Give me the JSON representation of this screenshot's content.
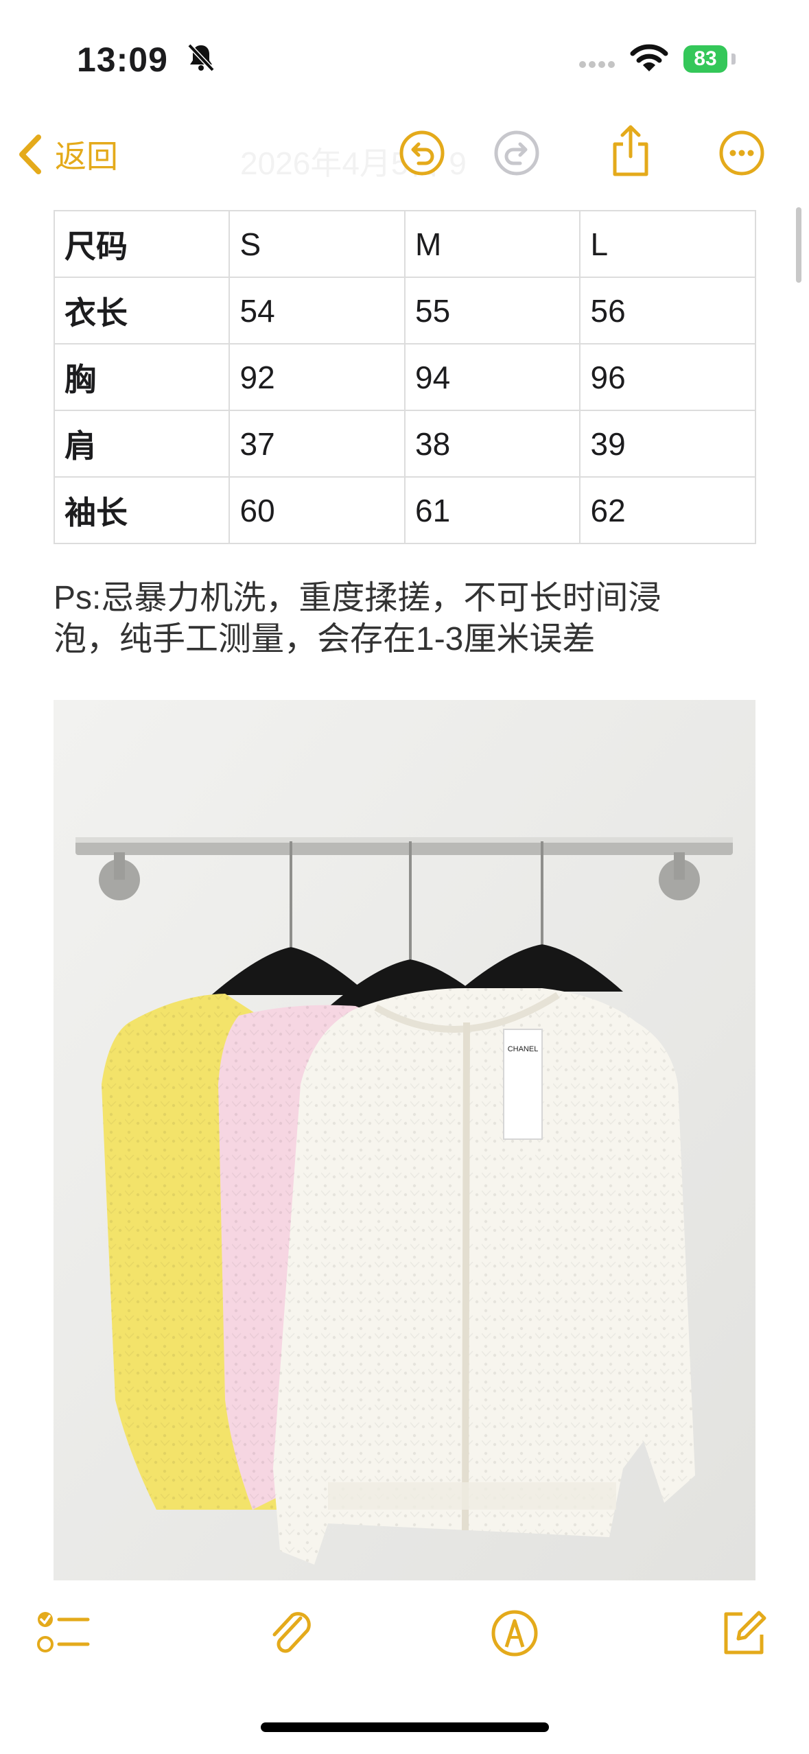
{
  "status_bar": {
    "time": "13:09",
    "battery": "83"
  },
  "nav": {
    "back_label": "返回",
    "title_faint": "2026年4月5日 9"
  },
  "table": {
    "header": [
      "尺码",
      "S",
      "M",
      "L"
    ],
    "rows": [
      [
        "衣长",
        "54",
        "55",
        "56"
      ],
      [
        "胸",
        "92",
        "94",
        "96"
      ],
      [
        "肩",
        "37",
        "38",
        "39"
      ],
      [
        "袖长",
        "60",
        "61",
        "62"
      ]
    ]
  },
  "note": {
    "line1": "Ps:忌暴力机洗，重度揉搓，不可长时间浸",
    "line2": "泡，纯手工测量，会存在1-3厘米误差"
  },
  "photo_label": {
    "brand": "CHANEL"
  },
  "colors": {
    "accent": "#e4aa1b",
    "battery": "#34c759",
    "cardigan_yellow": "#f3e36a",
    "cardigan_pink": "#f6d6e2",
    "cardigan_white": "#f7f5ee"
  },
  "icons": [
    "bell-slash-icon",
    "signal-dots-icon",
    "wifi-icon",
    "chevron-left-icon",
    "undo-icon",
    "redo-icon",
    "share-icon",
    "more-icon",
    "checklist-icon",
    "paperclip-icon",
    "markup-icon",
    "compose-icon"
  ]
}
